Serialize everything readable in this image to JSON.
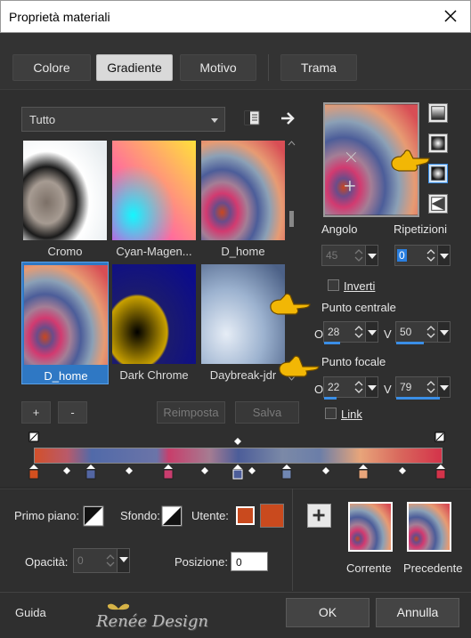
{
  "window": {
    "title": "Proprietà materiali"
  },
  "tabs": [
    {
      "label": "Colore",
      "active": false
    },
    {
      "label": "Gradiente",
      "active": true
    },
    {
      "label": "Motivo",
      "active": false
    },
    {
      "label": "Trama",
      "active": false
    }
  ],
  "library": {
    "dropdown_value": "Tutto",
    "thumbnails": [
      {
        "name": "Cromo",
        "selected": false
      },
      {
        "name": "Cyan-Magen...",
        "selected": false
      },
      {
        "name": "D_home",
        "selected": false
      },
      {
        "name": "D_home",
        "selected": true
      },
      {
        "name": "Dark Chrome",
        "selected": false
      },
      {
        "name": "Daybreak-jdr",
        "selected": false
      }
    ],
    "add_label": "+",
    "remove_label": "-",
    "reset_label": "Reimposta",
    "save_label": "Salva"
  },
  "gradient": {
    "angle_label": "Angolo",
    "angle_value": "45",
    "repeats_label": "Ripetizioni",
    "repeats_value": "0",
    "invert_label": "Inverti",
    "center_label": "Punto centrale",
    "center_o_prefix": "O",
    "center_o_value": "28",
    "center_v_prefix": "V",
    "center_v_value": "50",
    "focal_label": "Punto focale",
    "focal_o_prefix": "O",
    "focal_o_value": "22",
    "focal_v_prefix": "V",
    "focal_v_value": "79",
    "link_label": "Link"
  },
  "colors": {
    "accent": "#3a8ee6",
    "stop_orange": "#d4501f",
    "user_color": "#c94a1e"
  },
  "bottom": {
    "foreground_label": "Primo piano:",
    "background_label": "Sfondo:",
    "user_label": "Utente:",
    "opacity_label": "Opacità:",
    "opacity_value": "0",
    "position_label": "Posizione:",
    "position_value": "0",
    "current_label": "Corrente",
    "previous_label": "Precedente"
  },
  "footer": {
    "help_label": "Guida",
    "ok_label": "OK",
    "cancel_label": "Annulla",
    "watermark": "Renée Design"
  }
}
